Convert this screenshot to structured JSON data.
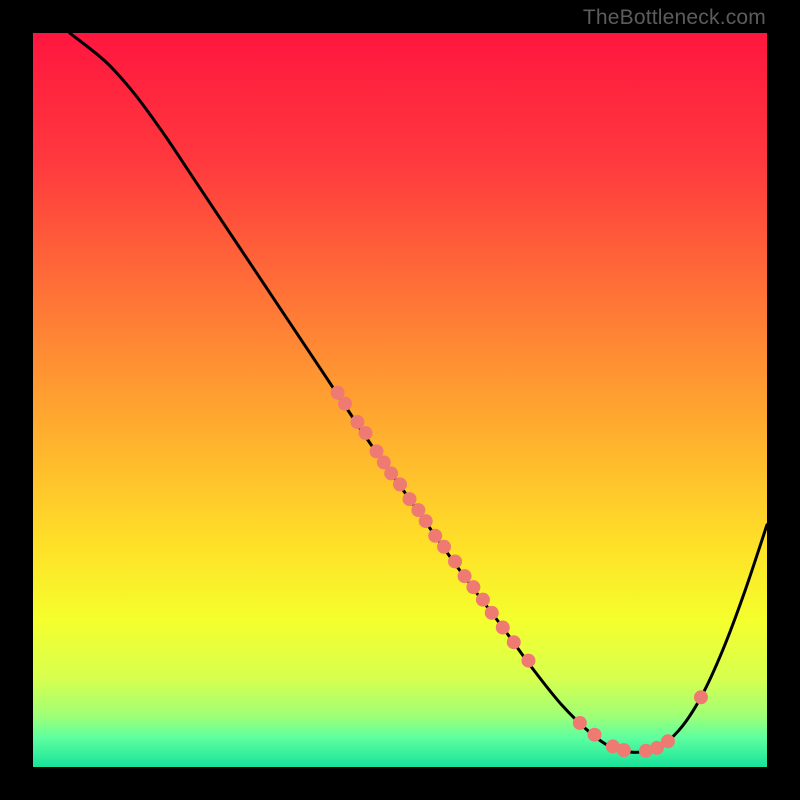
{
  "watermark": "TheBottleneck.com",
  "colors": {
    "curve": "#000000",
    "dots": "#ef7a72",
    "gradient_stops": [
      {
        "offset": "0%",
        "color": "#ff163f"
      },
      {
        "offset": "18%",
        "color": "#ff3a3e"
      },
      {
        "offset": "38%",
        "color": "#ff7a36"
      },
      {
        "offset": "55%",
        "color": "#ffb02e"
      },
      {
        "offset": "70%",
        "color": "#ffe128"
      },
      {
        "offset": "80%",
        "color": "#f4ff2d"
      },
      {
        "offset": "88%",
        "color": "#d7ff4f"
      },
      {
        "offset": "93%",
        "color": "#9fff76"
      },
      {
        "offset": "96%",
        "color": "#5effa0"
      },
      {
        "offset": "100%",
        "color": "#17e39a"
      }
    ]
  },
  "chart_data": {
    "type": "line",
    "title": "",
    "xlabel": "",
    "ylabel": "",
    "xlim": [
      0,
      100
    ],
    "ylim": [
      0,
      100
    ],
    "grid": false,
    "legend": false,
    "curve_xy": [
      [
        5,
        100
      ],
      [
        10,
        96
      ],
      [
        14,
        91.5
      ],
      [
        18,
        86
      ],
      [
        22,
        80
      ],
      [
        28,
        71
      ],
      [
        34,
        62
      ],
      [
        40,
        53
      ],
      [
        46,
        44
      ],
      [
        52,
        35.5
      ],
      [
        58,
        27
      ],
      [
        64,
        19
      ],
      [
        68,
        13.5
      ],
      [
        72,
        8.5
      ],
      [
        76,
        4.6
      ],
      [
        79,
        2.6
      ],
      [
        82,
        2.0
      ],
      [
        85,
        2.6
      ],
      [
        88,
        5.0
      ],
      [
        91,
        9.5
      ],
      [
        94,
        16
      ],
      [
        97,
        24
      ],
      [
        100,
        33
      ]
    ],
    "highlighted_points_xy": [
      [
        41.5,
        51.0
      ],
      [
        42.5,
        49.5
      ],
      [
        44.2,
        47.0
      ],
      [
        45.3,
        45.5
      ],
      [
        46.8,
        43.0
      ],
      [
        47.8,
        41.5
      ],
      [
        48.8,
        40.0
      ],
      [
        50.0,
        38.5
      ],
      [
        51.3,
        36.5
      ],
      [
        52.5,
        35.0
      ],
      [
        53.5,
        33.5
      ],
      [
        54.8,
        31.5
      ],
      [
        56.0,
        30.0
      ],
      [
        57.5,
        28.0
      ],
      [
        58.8,
        26.0
      ],
      [
        60.0,
        24.5
      ],
      [
        61.3,
        22.8
      ],
      [
        62.5,
        21.0
      ],
      [
        64.0,
        19.0
      ],
      [
        65.5,
        17.0
      ],
      [
        67.5,
        14.5
      ],
      [
        74.5,
        6.0
      ],
      [
        76.5,
        4.4
      ],
      [
        79.0,
        2.8
      ],
      [
        80.5,
        2.3
      ],
      [
        83.5,
        2.2
      ],
      [
        85.0,
        2.6
      ],
      [
        86.5,
        3.5
      ],
      [
        91.0,
        9.5
      ]
    ]
  }
}
